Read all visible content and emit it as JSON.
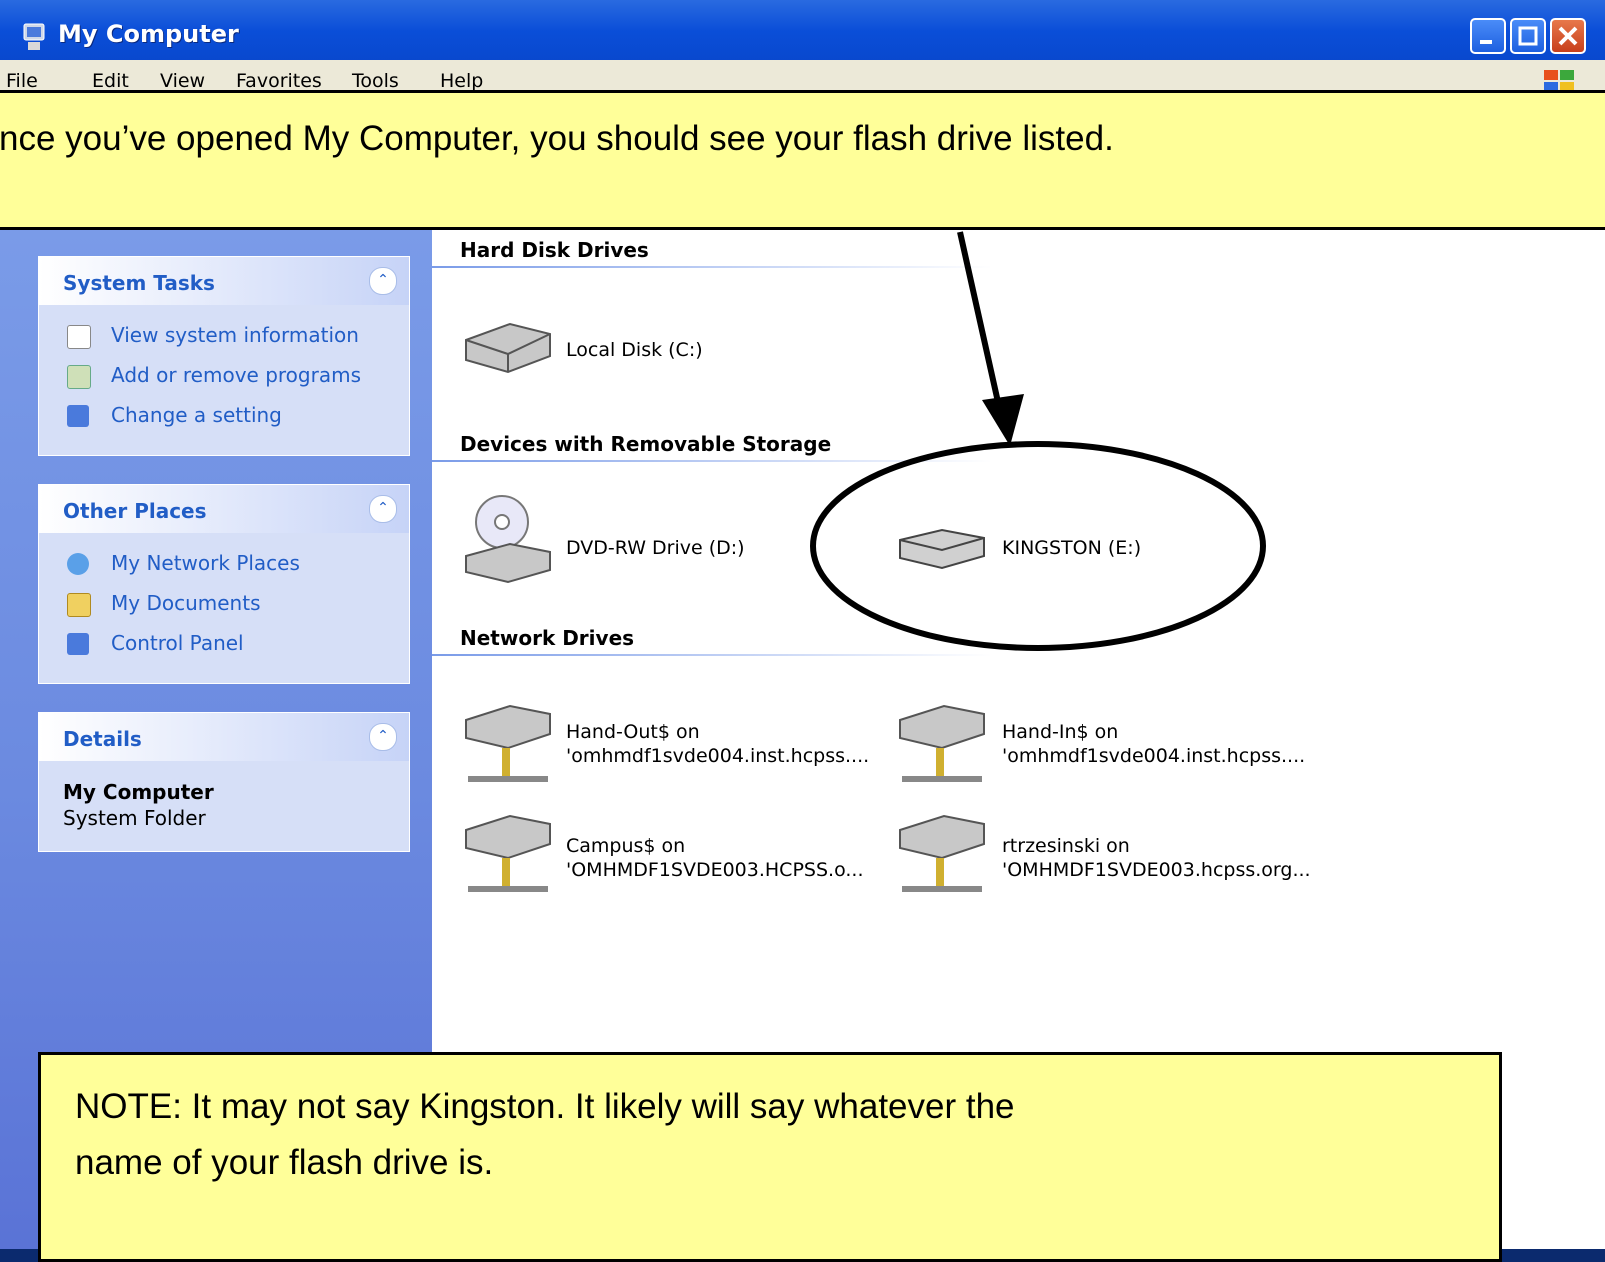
{
  "window": {
    "title": "My Computer"
  },
  "menu": [
    "File",
    "Edit",
    "View",
    "Favorites",
    "Tools",
    "Help"
  ],
  "callout_top": "nce you’ve opened My Computer, you should see your flash drive listed.",
  "callout_bottom": {
    "line1": "NOTE: It may not say Kingston. It likely will say whatever the",
    "line2": "name of your flash drive is."
  },
  "system_tasks": {
    "title": "System Tasks",
    "items": [
      "View system information",
      "Add or remove programs",
      "Change a setting"
    ]
  },
  "other_places": {
    "title": "Other Places",
    "items": [
      "My Network Places",
      "My Documents",
      "Control Panel"
    ]
  },
  "details": {
    "title": "Details",
    "name": "My Computer",
    "type": "System Folder"
  },
  "sections": {
    "hard": "Hard Disk Drives",
    "removable": "Devices with Removable Storage",
    "network": "Network Drives"
  },
  "drives": {
    "local": "Local Disk (C:)",
    "dvd": "DVD-RW Drive (D:)",
    "kingston": "KINGSTON (E:)",
    "handout": {
      "line1": "Hand-Out$ on",
      "line2": "'omhmdf1svde004.inst.hcpss...."
    },
    "handin": {
      "line1": "Hand-In$ on",
      "line2": "'omhmdf1svde004.inst.hcpss...."
    },
    "campus": {
      "line1": "Campus$ on",
      "line2": "'OMHMDF1SVDE003.HCPSS.o..."
    },
    "rtrz": {
      "line1": "rtrzesinski on",
      "line2": "'OMHMDF1SVDE003.hcpss.org..."
    }
  },
  "colors": {
    "titlebar": "#0a4ed8",
    "taskpane": "#6b8ae0",
    "link": "#215dc6",
    "callout": "#ffff99"
  }
}
